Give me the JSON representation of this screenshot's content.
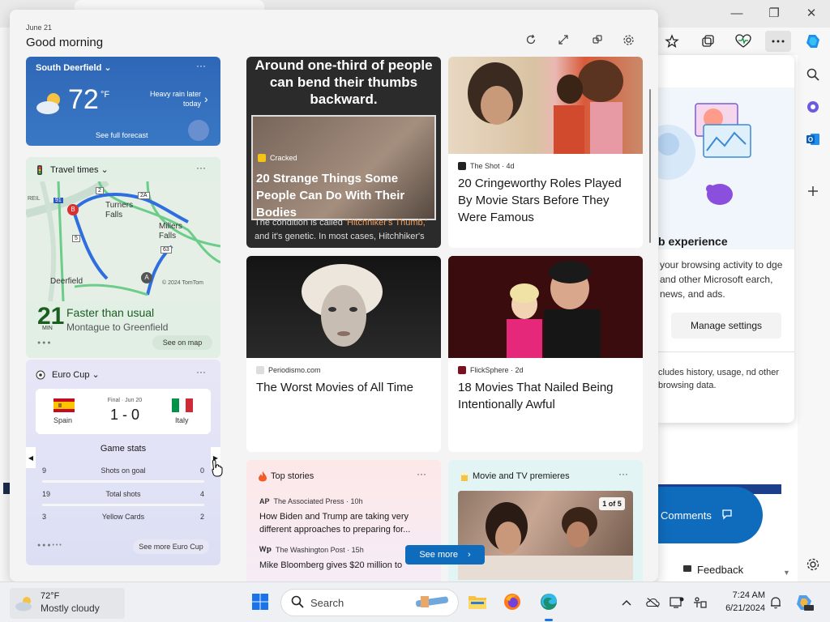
{
  "browser": {
    "window_controls": {
      "minimize": "—",
      "restore": "❐",
      "close": "✕"
    }
  },
  "flyout": {
    "title": "b experience",
    "description": "your browsing activity to dge and other Microsoft earch, news, and ads.",
    "manage_label": "Manage settings",
    "description2": "cludes history, usage, nd other browsing data."
  },
  "page_buttons": {
    "comments_label": "Comments",
    "feedback_label": "Feedback"
  },
  "widgets": {
    "date": "June 21",
    "greeting": "Good morning",
    "weather": {
      "location": "South Deerfield",
      "temperature": "72",
      "unit": "°F",
      "condition": "Heavy rain later today",
      "forecast_label": "See full forecast"
    },
    "travel": {
      "title": "Travel times",
      "minutes": "21",
      "minutes_unit": "MIN",
      "status": "Faster than usual",
      "route": "Montague to Greenfield",
      "see_map": "See on map",
      "map_labels": {
        "turners_falls": "Turners Falls",
        "millers_falls": "Millers Falls",
        "deerfield": "Deerfield",
        "copyright": "© 2024 TomTom",
        "route_2": "2",
        "route_2a": "2A",
        "route_63": "63",
        "route_5": "5",
        "route_91": "91",
        "route_b": "B",
        "route_a": "A",
        "side_label": "REIL"
      }
    },
    "euro": {
      "title": "Euro Cup",
      "home_team": "Spain",
      "away_team": "Italy",
      "match_meta": "Final · Jun 20",
      "score": "1 - 0",
      "stats_title": "Game stats",
      "stats": [
        {
          "home": "9",
          "label": "Shots on goal",
          "away": "0"
        },
        {
          "home": "19",
          "label": "Total shots",
          "away": "4"
        },
        {
          "home": "3",
          "label": "Yellow Cards",
          "away": "2"
        }
      ],
      "see_more": "See more Euro Cup"
    },
    "cracked": {
      "overlay_text": "Around one-third of people can bend their thumbs backward.",
      "source": "Cracked",
      "headline": "20 Strange Things Some People Can Do With Their Bodies",
      "snippet_pre": "The condition is called ",
      "snippet_highlight": "'Hitchhiker's Thumb,'",
      "snippet_post": " and it's genetic. In most cases, Hitchhiker's"
    },
    "shot": {
      "source": "The Shot · 4d",
      "headline": "20 Cringeworthy Roles Played By Movie Stars Before They Were Famous"
    },
    "worst": {
      "source": "Periodismo.com",
      "headline": "The Worst Movies of All Time"
    },
    "flick": {
      "source": "FlickSphere · 2d",
      "headline": "18 Movies That Nailed Being Intentionally Awful"
    },
    "top_stories": {
      "title": "Top stories",
      "items": [
        {
          "source": "The Associated Press · 10h",
          "headline": "How Biden and Trump are taking very different approaches to preparing for..."
        },
        {
          "source": "The Washington Post · 15h",
          "headline": "Mike Bloomberg gives $20 million to"
        }
      ],
      "see_more": "See more"
    },
    "movies": {
      "title": "Movie and TV premieres",
      "count": "1 of 5"
    }
  },
  "taskbar": {
    "weather_temp": "72°F",
    "weather_cond": "Mostly cloudy",
    "search_placeholder": "Search",
    "time": "7:24 AM",
    "date": "6/21/2024"
  }
}
